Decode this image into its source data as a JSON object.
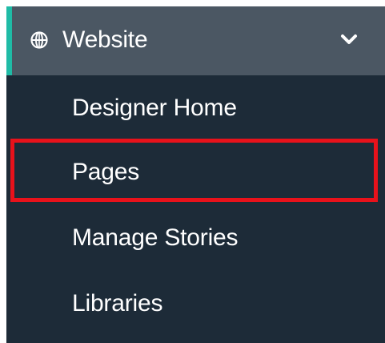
{
  "menu": {
    "header": {
      "label": "Website",
      "icon": "globe-icon",
      "toggle_icon": "chevron-down-icon",
      "accent_color": "#1fbba6"
    },
    "items": [
      {
        "label": "Designer Home"
      },
      {
        "label": "Pages"
      },
      {
        "label": "Manage Stories"
      },
      {
        "label": "Libraries"
      }
    ],
    "highlight_color": "#e8121b"
  }
}
